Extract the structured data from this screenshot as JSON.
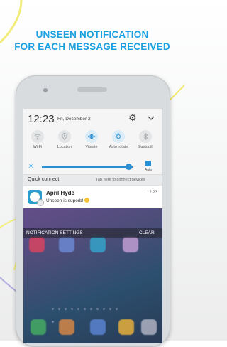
{
  "headline": {
    "line1": "UNSEEN NOTIFICATION",
    "line2": "FOR EACH MESSAGE RECEIVED"
  },
  "status_bar": {
    "time": "12:23",
    "date": "Fri, December 2",
    "settings_icon": "gear-icon",
    "expand_icon": "chevron-down-icon"
  },
  "quick_toggles": [
    {
      "label": "Wi-Fi",
      "icon": "wifi-icon",
      "active": false
    },
    {
      "label": "Location",
      "icon": "location-icon",
      "active": false
    },
    {
      "label": "Vibrate",
      "icon": "vibrate-icon",
      "active": true
    },
    {
      "label": "Auto rotate",
      "icon": "auto-rotate-icon",
      "active": true
    },
    {
      "label": "Bluetooth",
      "icon": "bluetooth-icon",
      "active": false
    }
  ],
  "brightness": {
    "level": 0.95,
    "auto_label": "Auto",
    "auto_checked": true
  },
  "quick_connect": {
    "title": "Quick connect",
    "hint": "Tap here to connect devices"
  },
  "notification": {
    "sender": "April Hyde",
    "message": "Unseen is superb!",
    "time": "12:23"
  },
  "notification_actions": {
    "settings_label": "NOTIFICATION SETTINGS",
    "clear_label": "CLEAR"
  },
  "colors": {
    "accent": "#2a8fd1",
    "headline": "#1aa0e0",
    "app_icon": "#2a9ccf"
  }
}
